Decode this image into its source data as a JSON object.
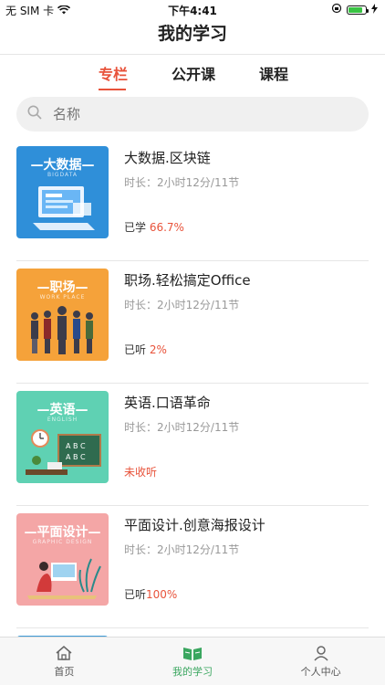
{
  "status": {
    "carrier": "无 SIM 卡",
    "time": "下午4:41",
    "battery_fraction": 0.85
  },
  "header": {
    "title": "我的学习"
  },
  "tabs": [
    {
      "label": "专栏",
      "active": true
    },
    {
      "label": "公开课",
      "active": false
    },
    {
      "label": "课程",
      "active": false
    }
  ],
  "search": {
    "placeholder": "名称"
  },
  "courses": [
    {
      "title": "大数据.区块链",
      "duration": "时长：2小时12分/11节",
      "progress_label": "已学 ",
      "progress_value": "66.7%",
      "thumb_title": "—大数据—",
      "thumb_sub": "BIGDATA",
      "thumb_color": "#2f8fd9"
    },
    {
      "title": "职场.轻松搞定Office",
      "duration": "时长：2小时12分/11节",
      "progress_label": "已听 ",
      "progress_value": "2%",
      "thumb_title": "—职场—",
      "thumb_sub": "WORK PLACE",
      "thumb_color": "#f5a23a"
    },
    {
      "title": "英语.口语革命",
      "duration": "时长：2小时12分/11节",
      "progress_label": "未收听",
      "progress_value": "",
      "thumb_title": "—英语—",
      "thumb_sub": "ENGLISH",
      "thumb_color": "#5fd1b3"
    },
    {
      "title": "平面设计.创意海报设计",
      "duration": "时长：2小时12分/11节",
      "progress_label": "已听",
      "progress_value": "100%",
      "thumb_title": "—平面设计—",
      "thumb_sub": "GRAPHIC DESIGN",
      "thumb_color": "#f4a6a6"
    }
  ],
  "tabbar": [
    {
      "label": "首页",
      "icon": "home-icon"
    },
    {
      "label": "我的学习",
      "icon": "book-icon",
      "active": true
    },
    {
      "label": "个人中心",
      "icon": "person-icon"
    }
  ],
  "colors": {
    "accent": "#e8523a",
    "active_tab": "#3aa65f"
  }
}
